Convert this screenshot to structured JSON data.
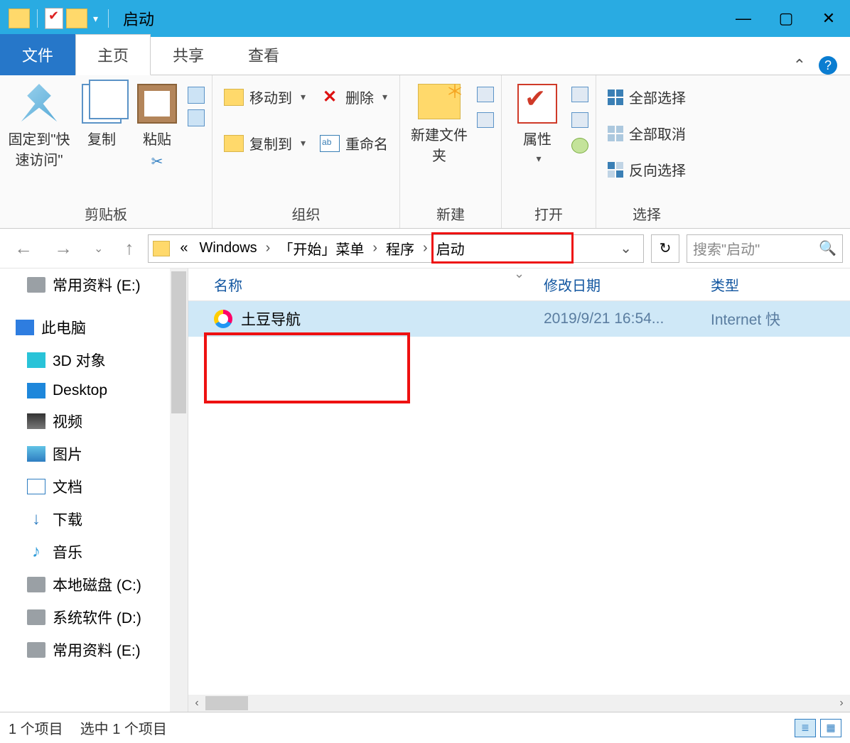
{
  "titlebar": {
    "title": "启动"
  },
  "tabs": {
    "file": "文件",
    "home": "主页",
    "share": "共享",
    "view": "查看"
  },
  "ribbon": {
    "clipboard": {
      "pin": "固定到\"快速访问\"",
      "copy": "复制",
      "paste": "粘贴",
      "label": "剪贴板"
    },
    "organize": {
      "moveTo": "移动到",
      "copyTo": "复制到",
      "delete": "删除",
      "rename": "重命名",
      "label": "组织"
    },
    "new": {
      "newFolder": "新建文件夹",
      "label": "新建"
    },
    "open": {
      "properties": "属性",
      "label": "打开"
    },
    "select": {
      "all": "全部选择",
      "none": "全部取消",
      "invert": "反向选择",
      "label": "选择"
    }
  },
  "breadcrumb": {
    "prefix": "«",
    "seg1": "Windows",
    "seg2": "「开始」菜单",
    "seg3": "程序",
    "seg4": "启动"
  },
  "search": {
    "placeholder": "搜索\"启动\""
  },
  "tree": {
    "e_top": "常用资料 (E:)",
    "pc": "此电脑",
    "d3": "3D 对象",
    "desk": "Desktop",
    "vid": "视频",
    "pic": "图片",
    "doc": "文档",
    "dl": "下载",
    "mus": "音乐",
    "c": "本地磁盘 (C:)",
    "d": "系统软件 (D:)",
    "e": "常用资料 (E:)"
  },
  "columns": {
    "name": "名称",
    "date": "修改日期",
    "type": "类型"
  },
  "file": {
    "name": "土豆导航",
    "date": "2019/9/21 16:54...",
    "type": "Internet 快"
  },
  "status": {
    "count": "1 个项目",
    "selected": "选中 1 个项目"
  }
}
